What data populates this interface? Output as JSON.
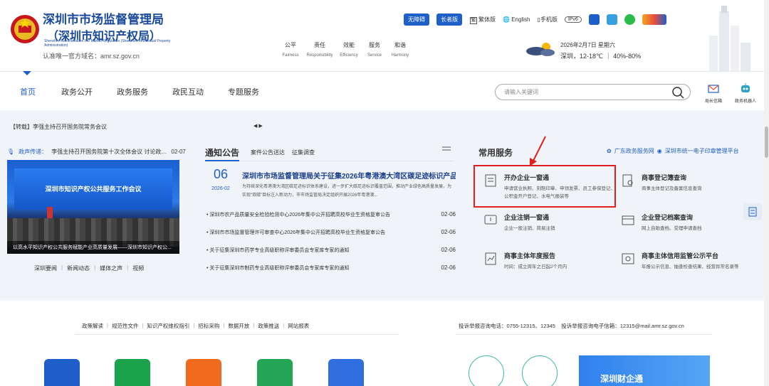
{
  "header": {
    "title_line1": "深圳市市场监督管理局",
    "title_line2": "（深圳市知识产权局）",
    "title_en": "Shenzhen Administration For Market Regulation (Shenzhen Intellectual Property Administration)",
    "domain": "认准唯一官方域名：amr.sz.gov.cn",
    "values": [
      {
        "zh": "公平",
        "en": "Fairness"
      },
      {
        "zh": "责任",
        "en": "Responsibility"
      },
      {
        "zh": "效能",
        "en": "Efficiency"
      },
      {
        "zh": "服务",
        "en": "Service"
      },
      {
        "zh": "和谐",
        "en": "Harmony"
      }
    ],
    "btn_accessible": "无障碍",
    "btn_elder": "长者版",
    "traditional": "繁体版",
    "traditional_glyph": "繁",
    "english": "English",
    "mobile": "手机版",
    "ipv6": "IPv6",
    "weather_date": "2026年2月7日 星期六",
    "weather_info": "深圳，12-18℃ ｜ 40%-80%"
  },
  "nav": {
    "items": [
      "首页",
      "政务公开",
      "政务服务",
      "政民互动",
      "专题服务"
    ],
    "active_index": 0,
    "search_placeholder": "请输入关键词",
    "mailbox_label": "局长信箱",
    "robot_label": "政务机器人"
  },
  "ticker": {
    "text": "【转载】李强主持召开国务院常务会议",
    "arrows": "◀ ▶"
  },
  "voice": {
    "label": "政声传递：",
    "text": "李强主持召开国务院第十次全体会议 讨论政…",
    "date": "02-07"
  },
  "photo": {
    "screen_text": "深圳市知识产权公共服务工作会议",
    "caption": "以高水平知识产权公共服务赋能产业高质量发展——深圳市知识产权公..."
  },
  "news_tabs": [
    "深圳要闻",
    "新闻动态",
    "媒体之声",
    "视频"
  ],
  "notices": {
    "title": "通知公告",
    "tabs": [
      "案件公告送达",
      "征集调查"
    ],
    "headline_day": "06",
    "headline_month": "2026-02",
    "headline": "深圳市市场监督管理局关于征集2026年粤港澳大湾区碳足迹标识产品...",
    "headline_summary": "为持续深化粤港澳大湾区碳足迹标识体系建设，进一步扩大碳足迹标识覆盖范围，推动产业绿色高质量发展，为实现“双碳”目标注入新动力，市市场监管局决定组织开展2026年粤港澳...",
    "items": [
      {
        "title": "深圳市农产品质量安全检验检测中心2026年集中公开招聘高校毕业生资格复审公告",
        "date": "02-06"
      },
      {
        "title": "深圳市市场监督管理许可审查中心2026年集中公开招聘高校毕业生资格复审公告",
        "date": "02-06"
      },
      {
        "title": "关于征集深圳市药学专业高级职称评审委员会专家库专家的通知",
        "date": "02-06"
      },
      {
        "title": "关于征集深圳市制药专业高级职称评审委员会专家库专家的通知",
        "date": "02-06"
      }
    ]
  },
  "services": {
    "title": "常用服务",
    "link1": "广东政务服务网",
    "link2": "深圳市统一电子印章管理平台",
    "items": [
      {
        "title": "开办企业一窗通",
        "desc": "申请营业执照、刻制印章、申领发票、员工参保登记、公积金开户登记、水电气报装等"
      },
      {
        "title": "商事登记簿查询",
        "desc": "商事主体登记及备案信息查询"
      },
      {
        "title": "企业注销一窗通",
        "desc": "企业一般注销、简易注销"
      },
      {
        "title": "企业登记档案查询",
        "desc": "网上自助查档、受理申请查档"
      },
      {
        "title": "商事主体年度报告",
        "desc": "时间：成立周年之日起2个月内"
      },
      {
        "title": "商事主体信用监管公示平台",
        "desc": "年报公示信息、抽查检查结果、经营异常名录等"
      }
    ]
  },
  "footer": {
    "links": [
      "政策解读",
      "规范性文件",
      "知识产权维权指引",
      "招标采购",
      "数据开放",
      "政策推送",
      "网站报表"
    ],
    "complaint": "投诉举报咨询电话：0755-12315、12345    投诉举报咨询电子信箱：12315@mail.amr.sz.gov.cn",
    "banner_text": "深圳财企通"
  },
  "colors": {
    "brand_blue": "#1f5fc9",
    "highlight_red": "#e02020"
  }
}
